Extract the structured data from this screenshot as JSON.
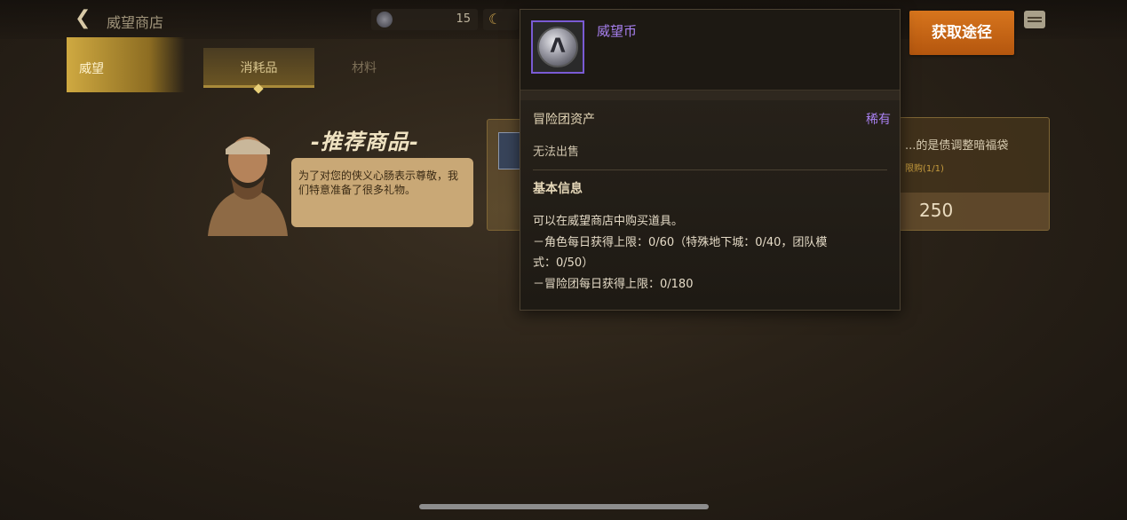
{
  "topbar": {
    "title": "威望商店",
    "currency_1_value": "15"
  },
  "tabs": [
    {
      "label": "威望"
    },
    {
      "label": "消耗品"
    },
    {
      "label": "材料"
    }
  ],
  "recommend": {
    "title": "-推荐商品-",
    "speech": "为了对您的侠义心肠表示尊敬，我们特意准备了很多礼物。"
  },
  "card_right": {
    "name": "...的是债调整暗福袋",
    "limit": "限购(1/1)",
    "price": "250"
  },
  "obtain_button": "获取途径",
  "tooltip": {
    "item_name": "威望币",
    "category": "冒险团资产",
    "rarity": "稀有",
    "sell_status": "无法出售",
    "basic_title": "基本信息",
    "desc_line1": "可以在威望商店中购买道具。",
    "desc_line2": "－角色每日获得上限：0/60（特殊地下城：0/40，团队模",
    "desc_line3": "式：0/50）",
    "desc_line4": "－冒险团每日获得上限：0/180"
  },
  "colors": {
    "rarity_purple": "#a880f0",
    "obtain_orange": "#c8651a",
    "tab_gold": "#cfa941"
  }
}
